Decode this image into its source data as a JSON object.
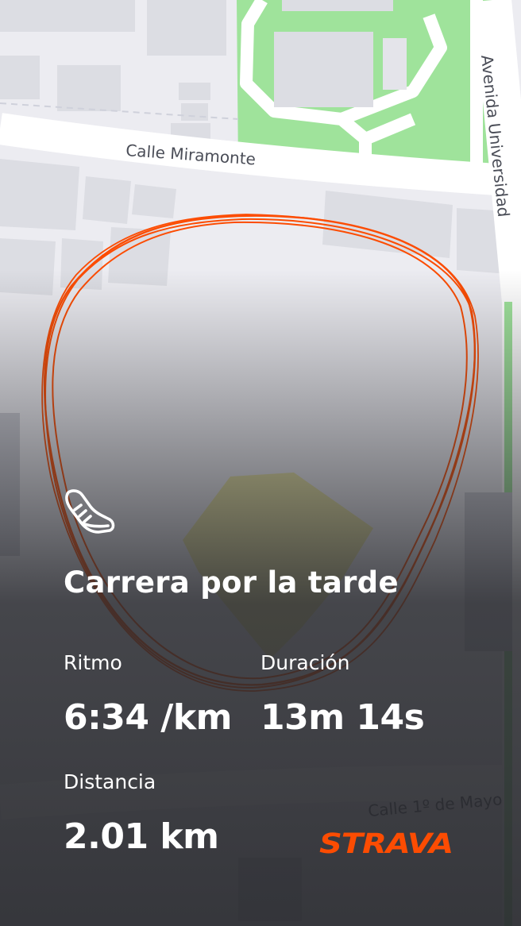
{
  "map": {
    "streets": {
      "miramonte": "Calle Miramonte",
      "universidad": "Avenida Universidad",
      "mayo": "Calle 1º de Mayo"
    },
    "colors": {
      "land": "#ececf1",
      "road": "#ffffff",
      "building": "#dcdde3",
      "park": "#9fe39b",
      "route": "#fc4c02"
    }
  },
  "activity": {
    "icon": "running-shoe-icon",
    "title": "Carrera por la tarde",
    "pace_label": "Ritmo",
    "pace_value": "6:34 /km",
    "duration_label": "Duración",
    "duration_value": "13m 14s",
    "distance_label": "Distancia",
    "distance_value": "2.01 km"
  },
  "brand": {
    "logo_text": "STRAVA",
    "color": "#fc4c02"
  }
}
